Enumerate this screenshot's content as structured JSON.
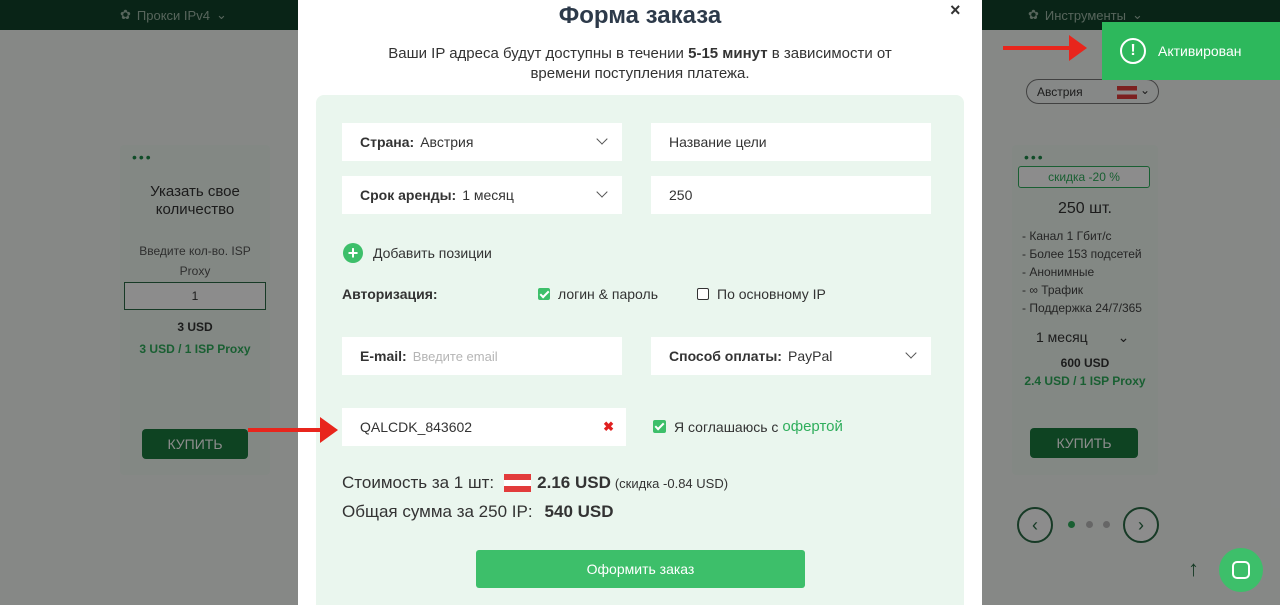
{
  "nav": {
    "proxy_ipv4": "Прокси IPv4",
    "tools": "Инструменты"
  },
  "left_card": {
    "title": "Указать свое количество",
    "hint": "Введите кол-во. ISP Proxy",
    "qty_value": "1",
    "price": "3 USD",
    "unit_price": "3 USD / 1 ISP Proxy",
    "buy": "КУПИТЬ"
  },
  "right_card": {
    "discount": "скидка -20 %",
    "amount": "250 шт.",
    "features": [
      "- Канал 1 Гбит/с",
      "- Более 153 подсетей",
      "- Анонимные",
      "- ∞ Трафик",
      "- Поддержка 24/7/365"
    ],
    "period": "1 месяц",
    "price": "600 USD",
    "unit_price": "2.4 USD / 1 ISP Proxy",
    "buy": "КУПИТЬ"
  },
  "country_select": "Австрия",
  "modal": {
    "title": "Форма заказа",
    "close": "×",
    "subtitle_pre": "Ваши IP адреса будут доступны в течении",
    "subtitle_bold": "5-15 минут",
    "subtitle_post": "в зависимости от времени поступления платежа.",
    "country_label": "Страна:",
    "country_value": "Австрия",
    "target_value": "Название цели",
    "term_label": "Срок аренды:",
    "term_value": "1 месяц",
    "qty_value": "250",
    "add_positions": "Добавить позиции",
    "auth_label": "Авторизация:",
    "auth_login": "логин & пароль",
    "auth_ip": "По основному IP",
    "email_label": "E-mail:",
    "email_placeholder": "Введите email",
    "payment_label": "Способ оплаты:",
    "payment_value": "PayPal",
    "promo_value": "QALCDK_843602",
    "agree_text": "Я соглашаюсь с",
    "agree_link": "офертой",
    "cost_label": "Стоимость за 1 шт:",
    "cost_value": "2.16 USD",
    "cost_discount": "(скидка -0.84 USD)",
    "total_label": "Общая сумма за 250 IP:",
    "total_value": "540 USD",
    "submit": "Оформить заказ"
  },
  "toast": {
    "text": "Активирован"
  },
  "colors": {
    "accent": "#3dbf6a",
    "toast": "#2db85c",
    "arrow": "#e8251c"
  }
}
